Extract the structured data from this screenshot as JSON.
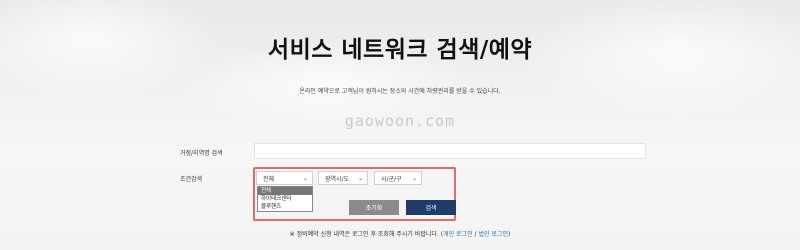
{
  "page": {
    "title": "서비스 네트워크 검색/예약",
    "subtitle": "온라인 예약으로 고객님이 원하시는 장소와 시간에 차량관리를 받을 수 있습니다.",
    "watermark": "gaowoon.com"
  },
  "form": {
    "location_label": "거점/지역명 검색",
    "location_value": "",
    "condition_label": "조건검색",
    "select_type": {
      "value": "전체",
      "options": [
        "전체",
        "하이테크센터",
        "블루핸즈"
      ]
    },
    "select_region": {
      "value": "광역시/도"
    },
    "select_city": {
      "value": "시/군/구"
    },
    "reset_label": "초기화",
    "search_label": "검색"
  },
  "notice": {
    "text": "※ 정비예약 신청 내역은 로그인 후 조회해 주시기 바랍니다.",
    "open_paren": "(",
    "personal_login": "개인 로그인",
    "separator": "/",
    "corporate_login": "법인 로그인",
    "close_paren": ")"
  },
  "colors": {
    "highlight": "#e06a6a",
    "search_button": "#1f3c68",
    "reset_button": "#8b8b8b",
    "link": "#2a6fb0"
  }
}
